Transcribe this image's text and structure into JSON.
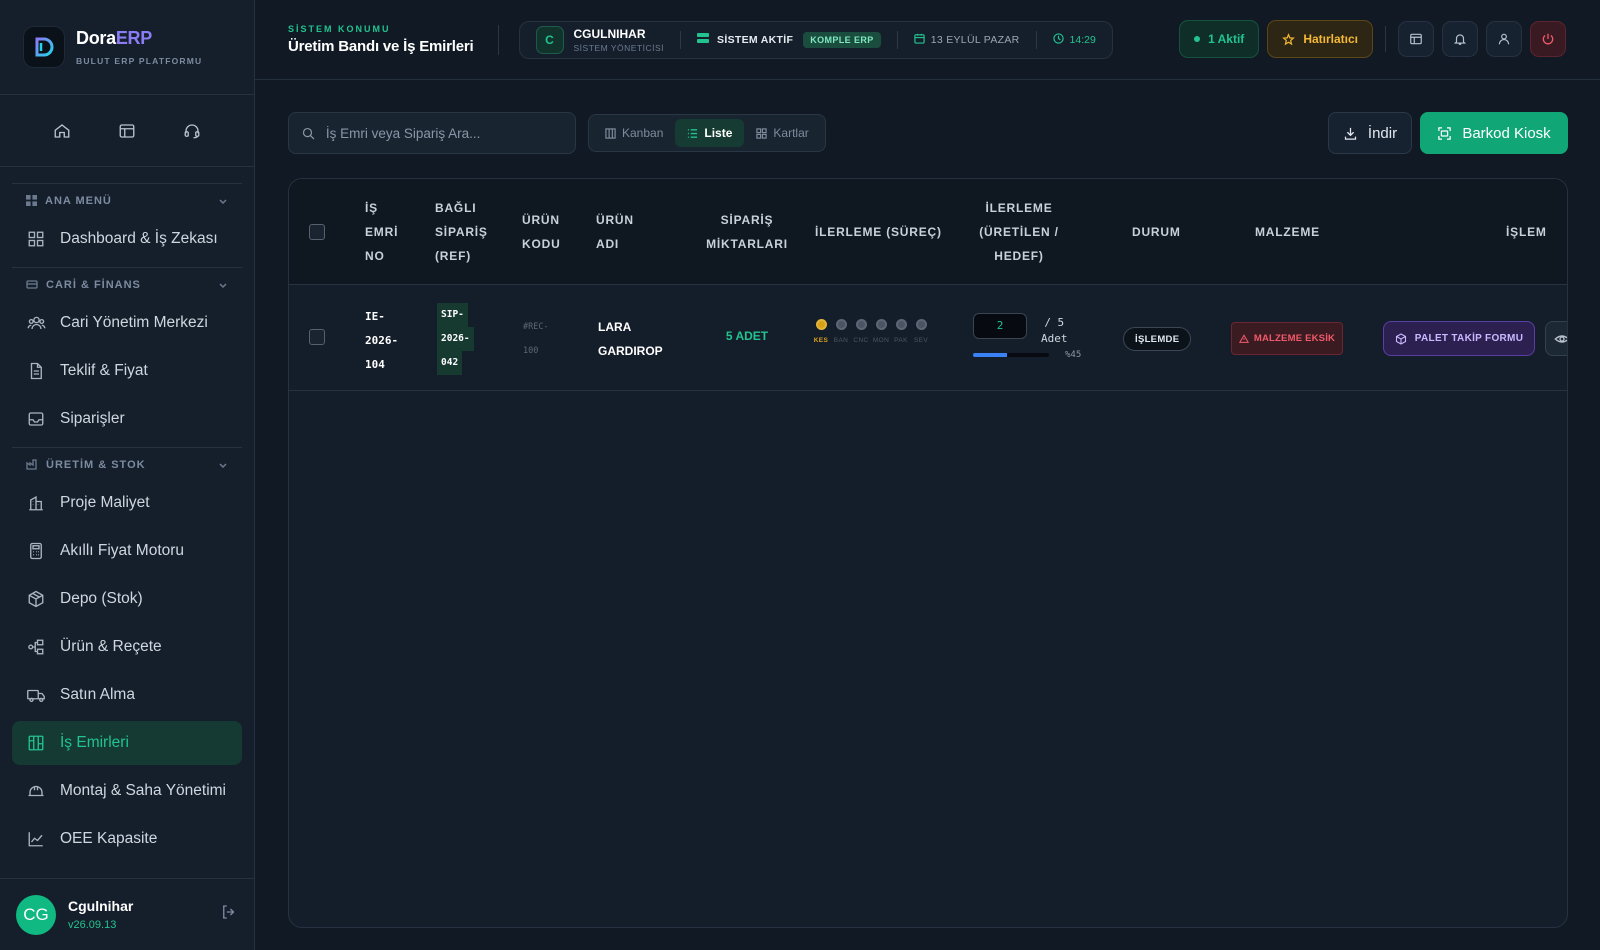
{
  "brand": {
    "name_main": "Dora",
    "name_accent": "ERP",
    "subtitle": "BULUT ERP PLATFORMU"
  },
  "sidebar": {
    "quick": [
      "home-icon",
      "layout-icon",
      "headset-icon"
    ],
    "sections": [
      {
        "label": "ANA MENÜ",
        "items": [
          {
            "label": "Dashboard & İş Zekası",
            "icon": "grid-icon"
          }
        ]
      },
      {
        "label": "CARİ & FİNANS",
        "items": [
          {
            "label": "Cari Yönetim Merkezi",
            "icon": "users-icon"
          },
          {
            "label": "Teklif & Fiyat",
            "icon": "document-icon"
          },
          {
            "label": "Siparişler",
            "icon": "inbox-icon"
          }
        ]
      },
      {
        "label": "ÜRETİM & STOK",
        "items": [
          {
            "label": "Proje Maliyet",
            "icon": "building-icon"
          },
          {
            "label": "Akıllı Fiyat Motoru",
            "icon": "calculator-icon"
          },
          {
            "label": "Depo (Stok)",
            "icon": "box-icon"
          },
          {
            "label": "Ürün & Reçete",
            "icon": "tree-icon"
          },
          {
            "label": "Satın Alma",
            "icon": "truck-icon"
          },
          {
            "label": "İş Emirleri",
            "icon": "kanban-icon",
            "active": true
          },
          {
            "label": "Montaj & Saha Yönetimi",
            "icon": "helmet-icon"
          },
          {
            "label": "OEE Kapasite",
            "icon": "chart-icon"
          }
        ]
      }
    ]
  },
  "user": {
    "initials": "CG",
    "name": "Cgulnihar",
    "version": "v26.09.13"
  },
  "header": {
    "eyebrow": "SİSTEM KONUMU",
    "title": "Üretim Bandı ve İş Emirleri",
    "status": {
      "badge": "C",
      "user": "CGULNIHAR",
      "role": "SİSTEM YÖNETİCİSİ",
      "system": "SİSTEM AKTİF",
      "edition": "KOMPLE ERP",
      "date": "13 EYLÜL PAZAR",
      "time": "14:29"
    },
    "active_label": "1 Aktif",
    "reminder_label": "Hatırlatıcı"
  },
  "toolbar": {
    "search_placeholder": "İş Emri veya Sipariş Ara...",
    "views": [
      {
        "label": "Kanban",
        "active": false
      },
      {
        "label": "Liste",
        "active": true
      },
      {
        "label": "Kartlar",
        "active": false
      }
    ],
    "download_label": "İndir",
    "kiosk_label": "Barkod Kiosk"
  },
  "table": {
    "headers": {
      "wo": [
        "İŞ",
        "EMRİ",
        "NO"
      ],
      "ref": [
        "BAĞLI",
        "SİPARİŞ",
        "(REF)"
      ],
      "code": [
        "ÜRÜN",
        "KODU"
      ],
      "name": [
        "ÜRÜN",
        "ADI"
      ],
      "qty": [
        "SİPARİŞ",
        "MİKTARLARI"
      ],
      "process": "İLERLEME (SÜREÇ)",
      "progress": [
        "İLERLEME",
        "(ÜRETİLEN /",
        "HEDEF)"
      ],
      "status": "DURUM",
      "material": "MALZEME",
      "action": "İŞLEM"
    },
    "rows": [
      {
        "wo": [
          "IE-",
          "2026-",
          "104"
        ],
        "ref": [
          "SIP-",
          "2026-",
          "042"
        ],
        "code": [
          "#REC-",
          "100"
        ],
        "name": [
          "LARA",
          "GARDIROP"
        ],
        "qty": "5 ADET",
        "steps": [
          {
            "label": "KES",
            "current": true
          },
          {
            "label": "BAN",
            "current": false
          },
          {
            "label": "CNC",
            "current": false
          },
          {
            "label": "MON",
            "current": false
          },
          {
            "label": "PAK",
            "current": false
          },
          {
            "label": "SEV",
            "current": false
          }
        ],
        "produced": "2",
        "target": "/ 5",
        "unit": "Adet",
        "progress_percent": 45,
        "progress_label": "%45",
        "status": "İŞLEMDE",
        "material": "MALZEME EKSİK",
        "action": "PALET TAKİP FORMU"
      }
    ]
  },
  "colors": {
    "accent": "#22c38e",
    "brand_accent": "#8b7cf6",
    "warning": "#f5b935",
    "danger": "#f05a6a",
    "progress": "#3b82f6",
    "step_current": "#d8a019"
  }
}
